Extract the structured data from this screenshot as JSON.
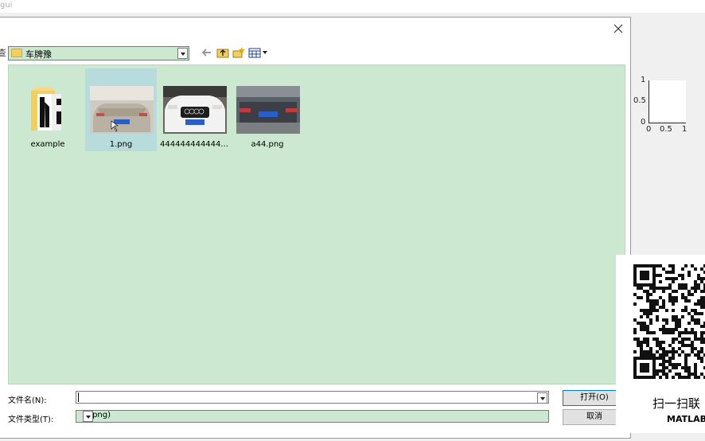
{
  "window": {
    "title": "gui"
  },
  "axes": {
    "y_ticks": [
      "1",
      "0.5",
      "0"
    ],
    "x_ticks": [
      "0",
      "0.5",
      "1"
    ]
  },
  "dialog": {
    "lookin_label": "查",
    "current_folder": "车牌豫",
    "files": [
      {
        "name": "example",
        "kind": "folder"
      },
      {
        "name": "1.png",
        "kind": "image"
      },
      {
        "name": "444444444444...",
        "kind": "image"
      },
      {
        "name": "a44.png",
        "kind": "image"
      }
    ],
    "filename_label": "文件名(N):",
    "filename_value": "",
    "filetype_label": "文件类型(T):",
    "filetype_value": "(*.png)",
    "open_button": "打开(O)",
    "cancel_button": "取消"
  },
  "overlay": {
    "scan_text": "扫一扫联",
    "brand_text": "MATLAB"
  }
}
